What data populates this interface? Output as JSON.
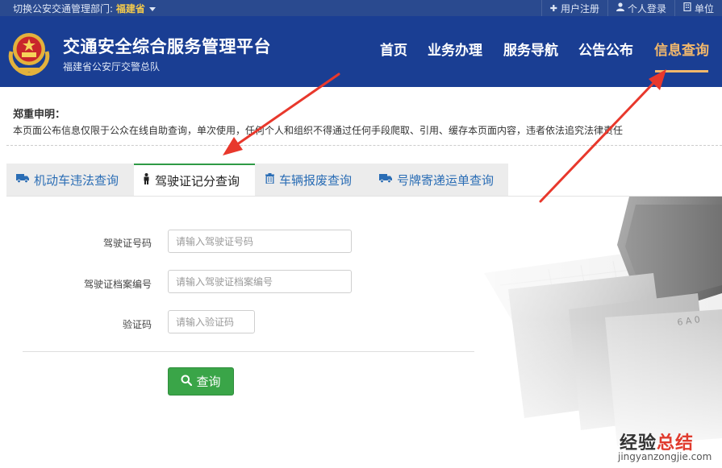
{
  "topbar": {
    "dept_label": "切换公安交通管理部门:",
    "province": "福建省",
    "register": "用户注册",
    "login": "个人登录",
    "third": "单位"
  },
  "header": {
    "title": "交通安全综合服务管理平台",
    "subtitle": "福建省公安厅交警总队",
    "nav": [
      "首页",
      "业务办理",
      "服务导航",
      "公告公布",
      "信息查询"
    ],
    "active_nav": "信息查询"
  },
  "notice": {
    "title": "郑重申明：",
    "text": "本页面公布信息仅限于公众在线自助查询，单次使用，任何个人和组织不得通过任何手段爬取、引用、缓存本页面内容，违者依法追究法律责任"
  },
  "tabs": [
    {
      "label": "机动车违法查询",
      "icon": "truck-icon"
    },
    {
      "label": "驾驶证记分查询",
      "icon": "person-icon"
    },
    {
      "label": "车辆报废查询",
      "icon": "trash-icon"
    },
    {
      "label": "号牌寄递运单查询",
      "icon": "truck-icon"
    }
  ],
  "active_tab": "驾驶证记分查询",
  "form": {
    "license_no_label": "驾驶证号码",
    "license_no_placeholder": "请输入驾驶证号码",
    "archive_no_label": "驾驶证档案编号",
    "archive_no_placeholder": "请输入驾驶证档案编号",
    "captcha_label": "验证码",
    "captcha_placeholder": "请输入验证码",
    "submit": "查询"
  },
  "watermark": {
    "text_a": "经验",
    "text_b": "总结",
    "url": "jingyanzongjie.com"
  },
  "colors": {
    "header_bg": "#1a3e93",
    "topbar_bg": "#2a4a8f",
    "active_nav": "#f2b86b",
    "tab_link": "#2a6db5",
    "submit_bg": "#3aa548",
    "arrow": "#e8382c"
  }
}
